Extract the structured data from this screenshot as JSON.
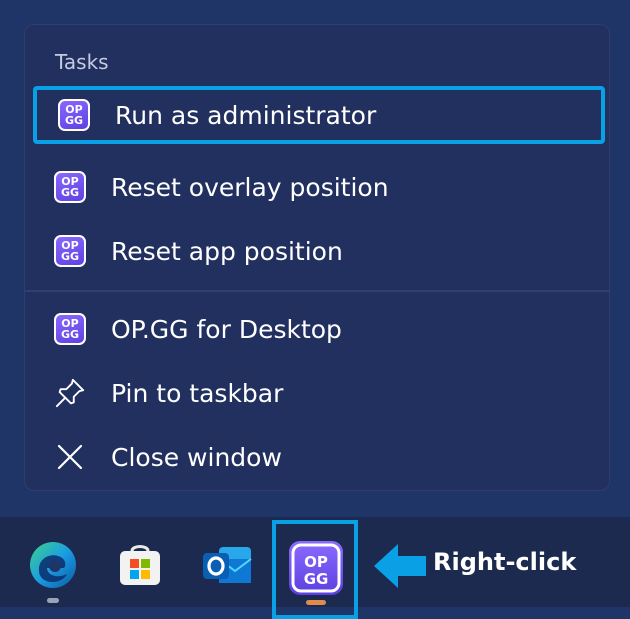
{
  "jumplist": {
    "section_label": "Tasks",
    "tasks": [
      {
        "label": "Run as administrator",
        "icon": "opgg-icon"
      },
      {
        "label": "Reset overlay position",
        "icon": "opgg-icon"
      },
      {
        "label": "Reset app position",
        "icon": "opgg-icon"
      }
    ],
    "items": [
      {
        "label": "OP.GG for Desktop",
        "icon": "opgg-icon"
      },
      {
        "label": "Pin to taskbar",
        "icon": "pin-icon"
      },
      {
        "label": "Close window",
        "icon": "close-icon"
      }
    ],
    "badge_text_top": "OP",
    "badge_text_bottom": "GG"
  },
  "taskbar": {
    "apps": [
      {
        "name": "edge-icon"
      },
      {
        "name": "store-icon"
      },
      {
        "name": "outlook-icon"
      },
      {
        "name": "opgg-icon"
      }
    ]
  },
  "annotation": {
    "callout_text": "Right-click"
  },
  "colors": {
    "highlight": "#0aa0e6",
    "menu_bg": "#223060",
    "taskbar_bg": "#1b2a4e",
    "opgg_purple": "#6e4ff0"
  }
}
